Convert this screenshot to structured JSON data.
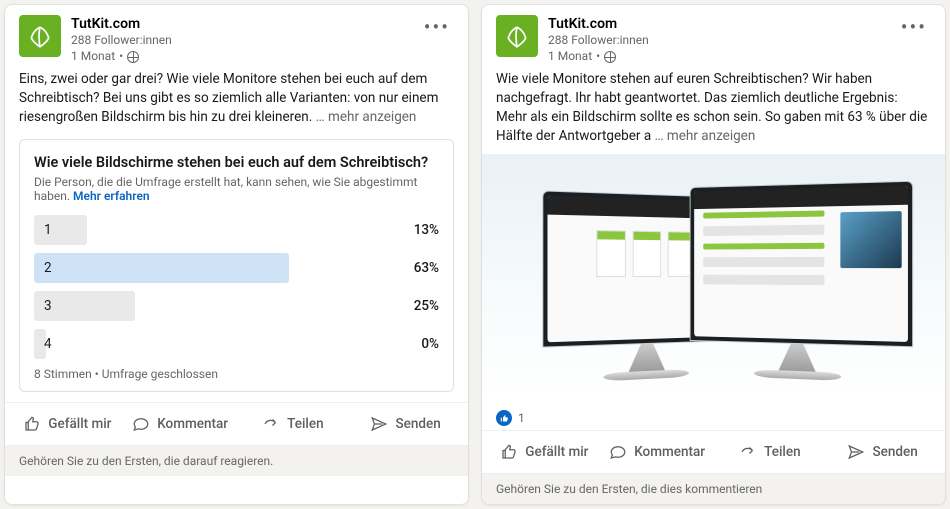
{
  "posts": [
    {
      "author": "TutKit.com",
      "followers": "288 Follower:innen",
      "age": "1 Monat",
      "body": "Eins, zwei oder gar drei? Wie viele Monitore stehen bei euch auf dem Schreibtisch? Bei uns gibt es so ziemlich alle Varianten: von nur einem riesengroßen Bildschirm bis hin zu drei kleineren.",
      "more": "… mehr anzeigen",
      "poll": {
        "title": "Wie viele Bildschirme stehen bei euch auf dem Schreibtisch?",
        "subtitle": "Die Person, die die Umfrage erstellt hat, kann sehen, wie Sie abgestimmt haben.",
        "learn_more": "Mehr erfahren",
        "options": [
          {
            "label": "1",
            "pct": 13,
            "selected": false
          },
          {
            "label": "2",
            "pct": 63,
            "selected": true
          },
          {
            "label": "3",
            "pct": 25,
            "selected": false
          },
          {
            "label": "4",
            "pct": 0,
            "selected": false
          }
        ],
        "footer": "8 Stimmen • Umfrage geschlossen"
      },
      "footer_note": "Gehören Sie zu den Ersten, die darauf reagieren."
    },
    {
      "author": "TutKit.com",
      "followers": "288 Follower:innen",
      "age": "1 Monat",
      "body": "Wie viele Monitore stehen auf euren Schreibtischen? Wir haben nachgefragt. Ihr habt geantwortet. Das ziemlich deutliche Ergebnis: Mehr als ein Bildschirm sollte es schon sein. So gaben mit 63 % über die Hälfte der Antwortgeber a",
      "more": "… mehr anzeigen",
      "reaction_count": "1",
      "footer_note": "Gehören Sie zu den Ersten, die dies kommentieren"
    }
  ],
  "actions": {
    "like": "Gefällt mir",
    "comment": "Kommentar",
    "share": "Teilen",
    "send": "Senden"
  },
  "chart_data": {
    "type": "bar",
    "title": "Wie viele Bildschirme stehen bei euch auf dem Schreibtisch?",
    "categories": [
      "1",
      "2",
      "3",
      "4"
    ],
    "values": [
      13,
      63,
      25,
      0
    ],
    "ylabel": "Prozent",
    "ylim": [
      0,
      100
    ],
    "n": 8,
    "status": "Umfrage geschlossen"
  }
}
